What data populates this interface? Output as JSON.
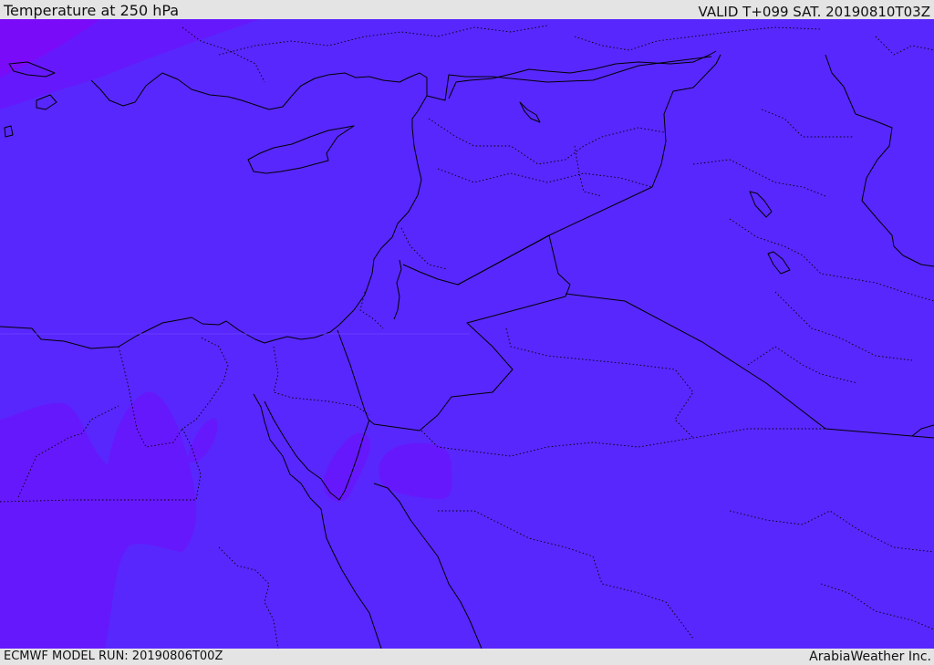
{
  "header": {
    "title": "Temperature at 250 hPa",
    "valid_time": "VALID T+099 SAT. 20190810T03Z"
  },
  "footer": {
    "model_run": "ECMWF MODEL RUN: 20190806T00Z",
    "credit": "ArabiaWeather Inc."
  },
  "map": {
    "colors": {
      "field_base": "#5827fd",
      "field_colder": "#6618fc",
      "field_coldest": "#7a0bf9",
      "land_border": "#000000"
    }
  }
}
